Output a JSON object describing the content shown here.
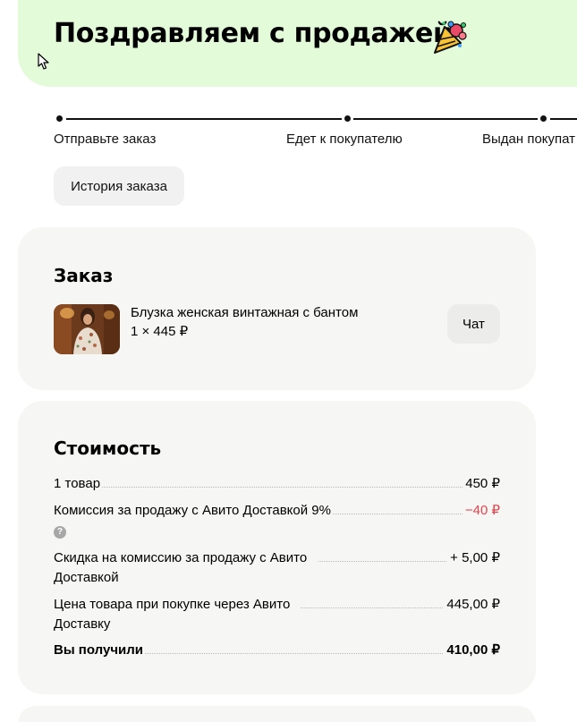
{
  "banner": {
    "title": "Поздравляем с продажей",
    "icon": "party-popper-icon",
    "background": "#e3fbd9"
  },
  "progress": {
    "steps": [
      {
        "label": "Отправьте заказ"
      },
      {
        "label": "Едет к покупателю"
      },
      {
        "label": "Выдан покупат"
      }
    ]
  },
  "history_button": {
    "label": "История заказа"
  },
  "order": {
    "title": "Заказ",
    "item": {
      "name": "Блузка женская винтажная с бантом",
      "quantity_price": "1 × 445 ₽"
    },
    "chat_button": "Чат"
  },
  "cost": {
    "title": "Стоимость",
    "rows": [
      {
        "label": "1 товар",
        "value": "450 ₽"
      },
      {
        "label": "Комиссия за продажу с Авито Доставкой 9%",
        "value": "−40 ₽",
        "value_color": "#e8424d"
      },
      {
        "label": "Скидка на комиссию за продажу с Авито Доставкой",
        "value": "+ 5,00 ₽"
      },
      {
        "label": "Цена товара при покупке через Авито Доставку",
        "value": "445,00 ₽"
      },
      {
        "label": "Вы получили",
        "value": "410,00 ₽"
      }
    ],
    "help_icon": "question-icon"
  }
}
